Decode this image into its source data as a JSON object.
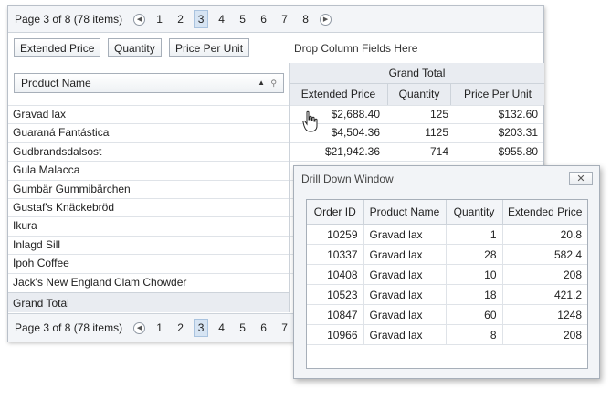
{
  "pager": {
    "info": "Page 3 of 8 (78 items)",
    "pages": [
      "1",
      "2",
      "3",
      "4",
      "5",
      "6",
      "7",
      "8"
    ],
    "active_page": "3"
  },
  "field_buttons": [
    "Extended Price",
    "Quantity",
    "Price Per Unit"
  ],
  "drop_text": "Drop Column Fields Here",
  "row_field": "Product Name",
  "column_header": {
    "grand_total": "Grand Total",
    "columns": [
      "Extended Price",
      "Quantity",
      "Price Per Unit"
    ]
  },
  "rows": [
    {
      "name": "Gravad lax",
      "ext": "$2,688.40",
      "qty": "125",
      "ppu": "$132.60"
    },
    {
      "name": "Guaraná Fantástica",
      "ext": "$4,504.36",
      "qty": "1125",
      "ppu": "$203.31"
    },
    {
      "name": "Gudbrandsdalsost",
      "ext": "$21,942.36",
      "qty": "714",
      "ppu": "$955.80"
    },
    {
      "name": "Gula Malacca",
      "ext": "",
      "qty": "",
      "ppu": ""
    },
    {
      "name": "Gumbär Gummibärchen",
      "ext": "",
      "qty": "",
      "ppu": ""
    },
    {
      "name": "Gustaf's Knäckebröd",
      "ext": "",
      "qty": "",
      "ppu": ""
    },
    {
      "name": "Ikura",
      "ext": "",
      "qty": "",
      "ppu": ""
    },
    {
      "name": "Inlagd Sill",
      "ext": "",
      "qty": "",
      "ppu": ""
    },
    {
      "name": "Ipoh Coffee",
      "ext": "",
      "qty": "",
      "ppu": ""
    },
    {
      "name": "Jack's New England Clam Chowder",
      "ext": "",
      "qty": "",
      "ppu": ""
    }
  ],
  "grand_total_row": "Grand Total",
  "drill": {
    "title": "Drill Down Window",
    "close_label": "✕",
    "headers": [
      "Order ID",
      "Product Name",
      "Quantity",
      "Extended Price"
    ],
    "rows": [
      [
        "10259",
        "Gravad lax",
        "1",
        "20.8"
      ],
      [
        "10337",
        "Gravad lax",
        "28",
        "582.4"
      ],
      [
        "10408",
        "Gravad lax",
        "10",
        "208"
      ],
      [
        "10523",
        "Gravad lax",
        "18",
        "421.2"
      ],
      [
        "10847",
        "Gravad lax",
        "60",
        "1248"
      ],
      [
        "10966",
        "Gravad lax",
        "8",
        "208"
      ]
    ]
  }
}
